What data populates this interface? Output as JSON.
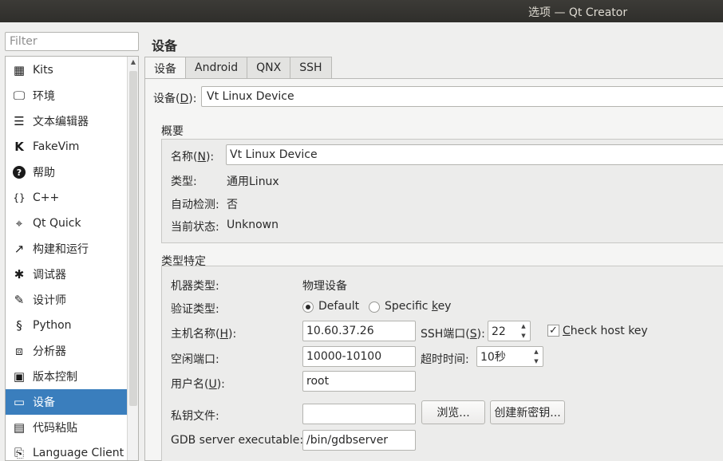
{
  "window": {
    "title": "选项 — Qt Creator"
  },
  "filter": {
    "placeholder": "Filter"
  },
  "sidebar": {
    "items": [
      {
        "label": "Kits",
        "icon": "kits-icon"
      },
      {
        "label": "环境",
        "icon": "monitor-icon"
      },
      {
        "label": "文本编辑器",
        "icon": "text-editor-icon"
      },
      {
        "label": "FakeVim",
        "icon": "fakevim-icon"
      },
      {
        "label": "帮助",
        "icon": "help-icon"
      },
      {
        "label": "C++",
        "icon": "braces-icon"
      },
      {
        "label": "Qt Quick",
        "icon": "qt-quick-icon"
      },
      {
        "label": "构建和运行",
        "icon": "hammer-icon"
      },
      {
        "label": "调试器",
        "icon": "bug-icon"
      },
      {
        "label": "设计师",
        "icon": "pen-icon"
      },
      {
        "label": "Python",
        "icon": "python-icon"
      },
      {
        "label": "分析器",
        "icon": "analyzer-icon"
      },
      {
        "label": "版本控制",
        "icon": "version-control-icon"
      },
      {
        "label": "设备",
        "icon": "devices-icon",
        "active": true
      },
      {
        "label": "代码粘贴",
        "icon": "code-paste-icon"
      },
      {
        "label": "Language Client",
        "icon": "language-client-icon"
      }
    ]
  },
  "page": {
    "title": "设备"
  },
  "tabs": [
    {
      "label": "设备",
      "active": true
    },
    {
      "label": "Android"
    },
    {
      "label": "QNX"
    },
    {
      "label": "SSH"
    }
  ],
  "device_selector": {
    "label_pre": "设备(",
    "mnemonic": "D",
    "label_post": "):",
    "value": "Vt Linux Device"
  },
  "overview": {
    "title": "概要",
    "name_label_pre": "名称(",
    "name_mnemonic": "N",
    "name_label_post": "):",
    "name_value": "Vt Linux Device",
    "type_label": "类型:",
    "type_value": "通用Linux",
    "autodetect_label": "自动检测:",
    "autodetect_value": "否",
    "state_label": "当前状态:",
    "state_value": "Unknown"
  },
  "type_specific": {
    "title": "类型特定",
    "machine_type_label": "机器类型:",
    "machine_type_value": "物理设备",
    "auth_type_label": "验证类型:",
    "auth_default": "Default",
    "auth_specific_pre": "Specific ",
    "auth_specific_mnemonic": "k",
    "auth_specific_post": "ey",
    "host_label_pre": "主机名称(",
    "host_mnemonic": "H",
    "host_label_post": "):",
    "host_value": "10.60.37.26",
    "ssh_port_label_pre": "SSH端口(",
    "ssh_port_mnemonic": "S",
    "ssh_port_label_post": "):",
    "ssh_port_value": "22",
    "check_host_key_label_pre": "",
    "check_host_key_mnemonic": "C",
    "check_host_key_label_post": "heck host key",
    "free_ports_label": "空闲端口:",
    "free_ports_value": "10000-10100",
    "timeout_label": "超时时间:",
    "timeout_value": "10秒",
    "username_label_pre": "用户名(",
    "username_mnemonic": "U",
    "username_label_post": "):",
    "username_value": "root",
    "private_key_label": "私钥文件:",
    "private_key_value": "",
    "browse_button": "浏览...",
    "create_key_button": "创建新密钥...",
    "gdb_label": "GDB server executable:",
    "gdb_value": "/bin/gdbserver"
  }
}
